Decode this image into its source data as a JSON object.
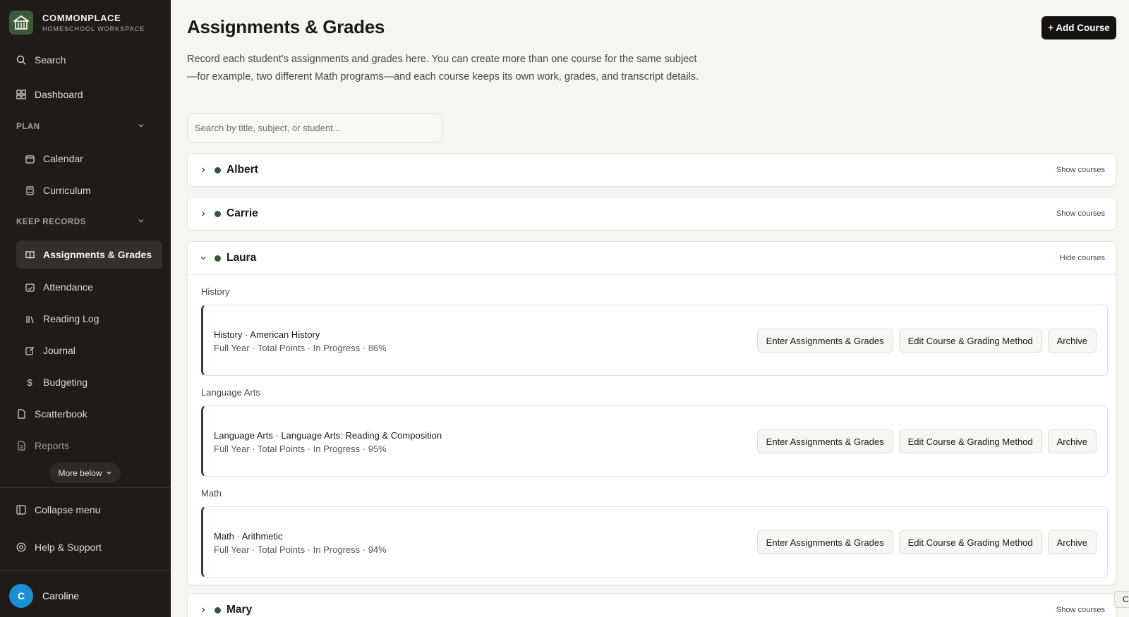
{
  "brand": {
    "name": "COMMONPLACE",
    "subtitle": "HOMESCHOOL WORKSPACE"
  },
  "sidebar": {
    "search": "Search",
    "dashboard": "Dashboard",
    "plan_header": "PLAN",
    "calendar": "Calendar",
    "curriculum": "Curriculum",
    "records_header": "KEEP RECORDS",
    "assignments": "Assignments & Grades",
    "attendance": "Attendance",
    "reading_log": "Reading Log",
    "journal": "Journal",
    "budgeting": "Budgeting",
    "scatterbook": "Scatterbook",
    "reports": "Reports",
    "more_below": "More below",
    "collapse": "Collapse menu",
    "help": "Help & Support",
    "user_initial": "C",
    "user_name": "Caroline"
  },
  "main": {
    "title": "Assignments & Grades",
    "add_course": "+ Add Course",
    "description": "Record each student's assignments and grades here. You can create more than one course for the same subject—for example, two different Math programs—and each course keeps its own work, grades, and transcript details.",
    "search_placeholder": "Search by title, subject, or student..."
  },
  "students": [
    {
      "name": "Albert",
      "toggle": "Show courses"
    },
    {
      "name": "Carrie",
      "toggle": "Show courses"
    },
    {
      "name": "Laura",
      "toggle": "Hide courses"
    },
    {
      "name": "Mary",
      "toggle": "Show courses"
    }
  ],
  "laura_courses": [
    {
      "subject": "History",
      "title": "History · American History",
      "meta": "Full Year · Total Points · In Progress · 86%"
    },
    {
      "subject": "Language Arts",
      "title": "Language Arts · Language Arts: Reading & Composition",
      "meta": "Full Year · Total Points · In Progress · 95%"
    },
    {
      "subject": "Math",
      "title": "Math · Arithmetic",
      "meta": "Full Year · Total Points · In Progress · 94%"
    }
  ],
  "course_actions": {
    "enter": "Enter Assignments & Grades",
    "edit": "Edit Course & Grading Method",
    "archive": "Archive"
  },
  "corner_tab": "C",
  "colors": {
    "sidebar": "#1f1b18",
    "accent_green": "#2d5a35",
    "avatar": "#1a8fd1",
    "primary_button": "#15120f"
  }
}
